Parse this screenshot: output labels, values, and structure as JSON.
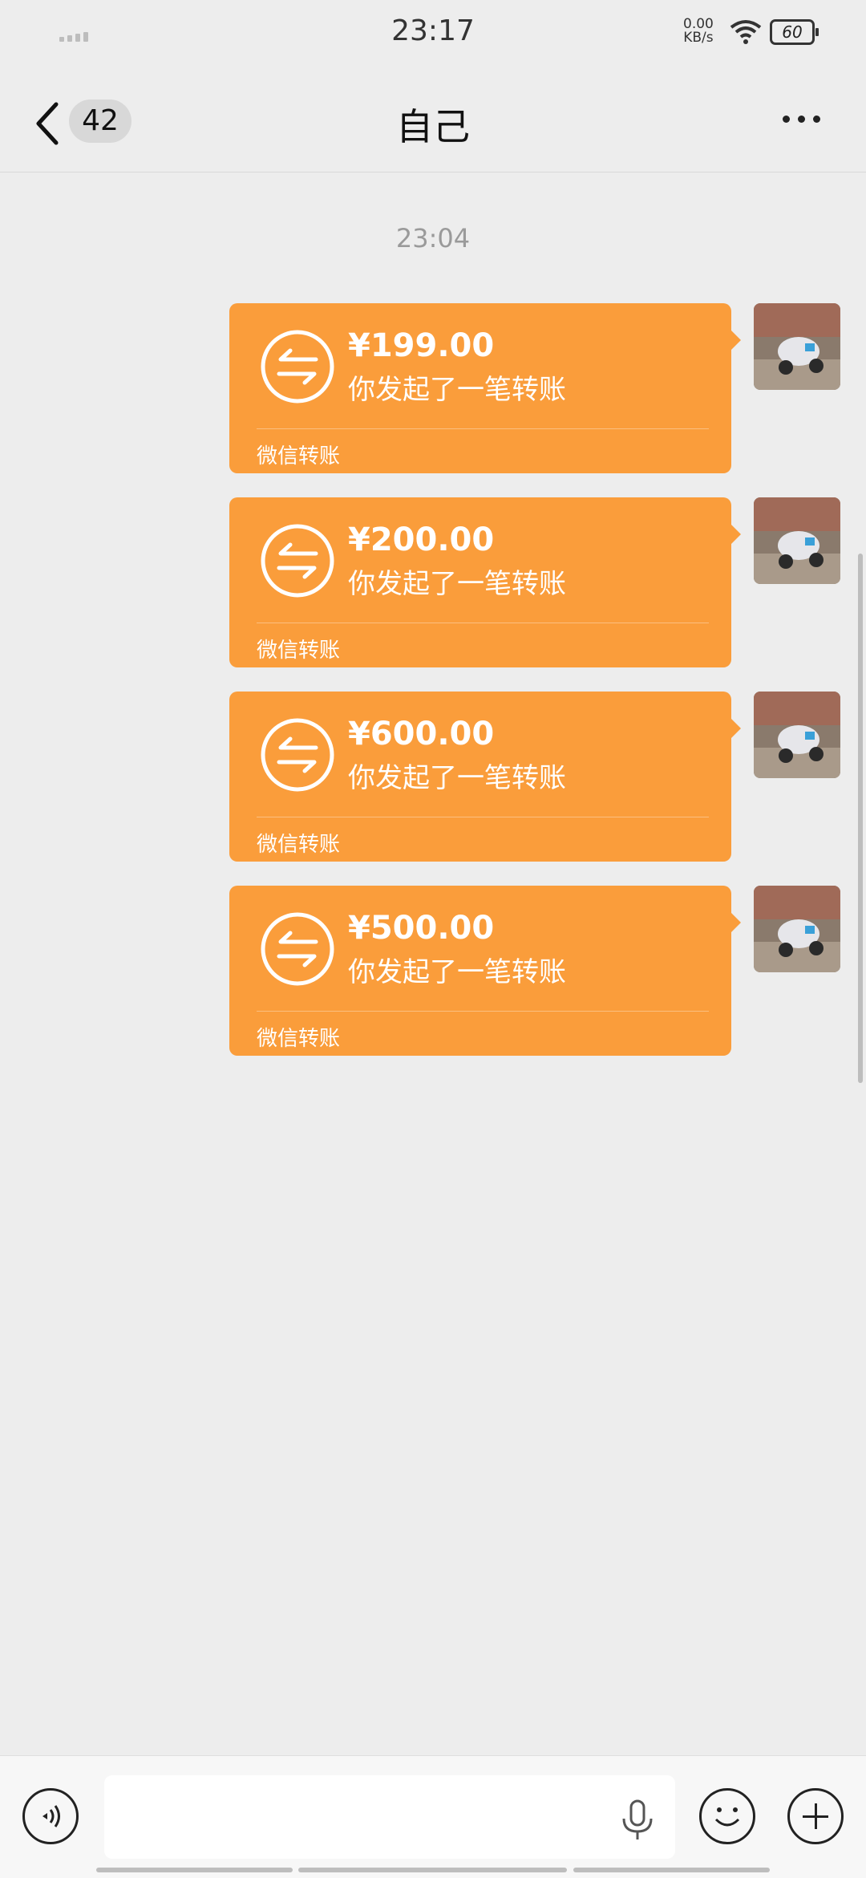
{
  "status_bar": {
    "time": "23:17",
    "net_speed_value": "0.00",
    "net_speed_unit": "KB/s",
    "battery": "60"
  },
  "nav": {
    "unread_count": "42",
    "title": "自己"
  },
  "chat": {
    "timestamp": "23:04",
    "messages": [
      {
        "amount": "¥199.00",
        "description": "你发起了一笔转账",
        "footer": "微信转账"
      },
      {
        "amount": "¥200.00",
        "description": "你发起了一笔转账",
        "footer": "微信转账"
      },
      {
        "amount": "¥600.00",
        "description": "你发起了一笔转账",
        "footer": "微信转账"
      },
      {
        "amount": "¥500.00",
        "description": "你发起了一笔转账",
        "footer": "微信转账"
      }
    ]
  },
  "colors": {
    "bubble": "#fa9d3b",
    "background": "#ededed"
  },
  "icons": [
    "back-icon",
    "more-icon",
    "transfer-icon",
    "voice-icon",
    "mic-icon",
    "emoji-icon",
    "plus-icon"
  ]
}
